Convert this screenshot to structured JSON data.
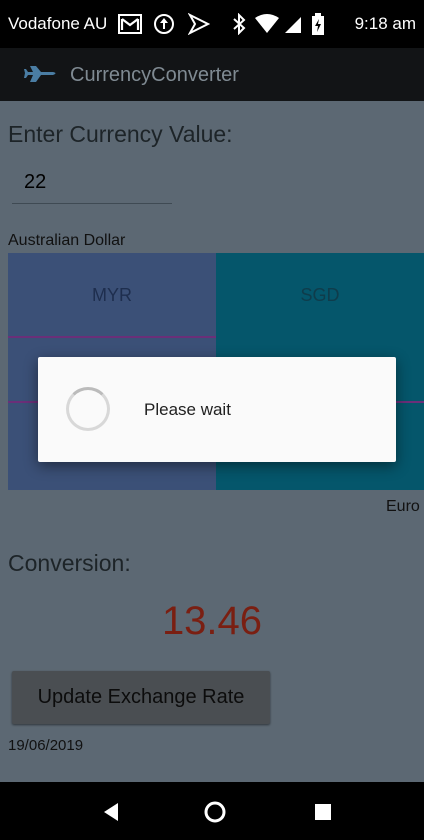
{
  "status_bar": {
    "carrier": "Vodafone AU",
    "time": "9:18 am",
    "icons": [
      "gmail-icon",
      "sync-icon",
      "navigation-icon",
      "bluetooth-icon",
      "wifi-icon",
      "signal-icon",
      "battery-icon"
    ]
  },
  "app_bar": {
    "title": "CurrencyConverter",
    "logo_icon": "airplane-icon"
  },
  "form": {
    "enter_label": "Enter Currency Value:",
    "input_value": "22",
    "currency_label": "Australian Dollar"
  },
  "currency_grid": {
    "cells": [
      "MYR",
      "SGD"
    ],
    "euro_label": "Euro"
  },
  "result": {
    "conversion_label": "Conversion:",
    "value": "13.46",
    "value_color": "#7a1f12"
  },
  "update_button": "Update Exchange Rate",
  "date": "19/06/2019",
  "dialog": {
    "message": "Please wait"
  },
  "nav_bar": {
    "buttons": [
      "back-icon",
      "home-icon",
      "recents-icon"
    ]
  },
  "colors": {
    "background_dimmed": "#5c6873",
    "cell_blue": "#3b5077",
    "cell_teal": "#05566b",
    "divider_purple": "#6b2f79"
  }
}
